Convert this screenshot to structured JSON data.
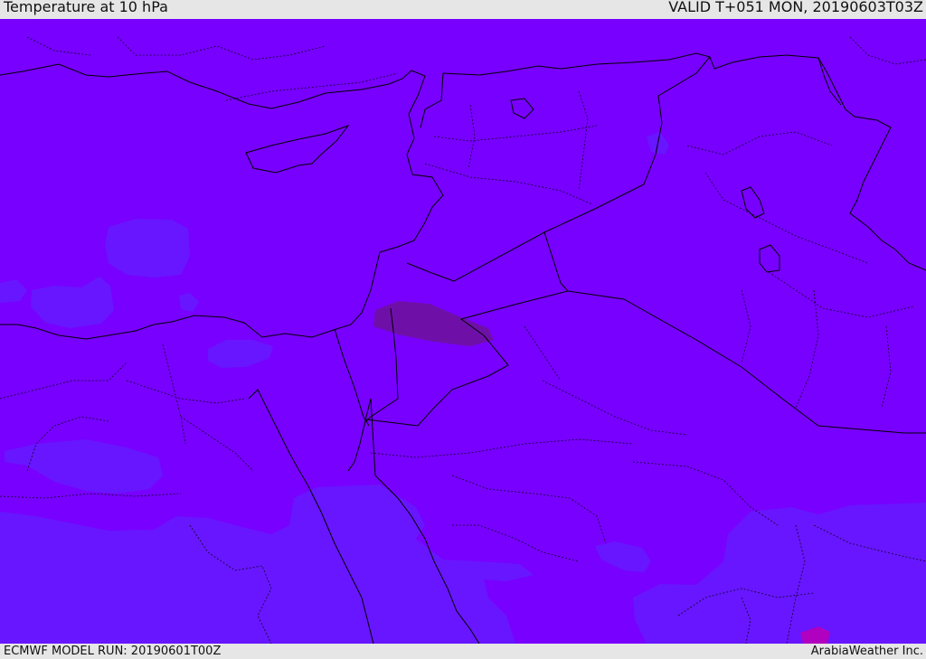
{
  "header": {
    "title": "Temperature at 10 hPa",
    "valid_time": "VALID T+051 MON, 20190603T03Z"
  },
  "footer": {
    "model_run": "ECMWF MODEL RUN: 20190601T00Z",
    "credit": "ArabiaWeather Inc."
  },
  "map": {
    "colors": {
      "background_band": "#7800ff",
      "cooler_band": "#6816ff",
      "warm_spot": "#6e10a8",
      "border_line": "#000000"
    }
  }
}
